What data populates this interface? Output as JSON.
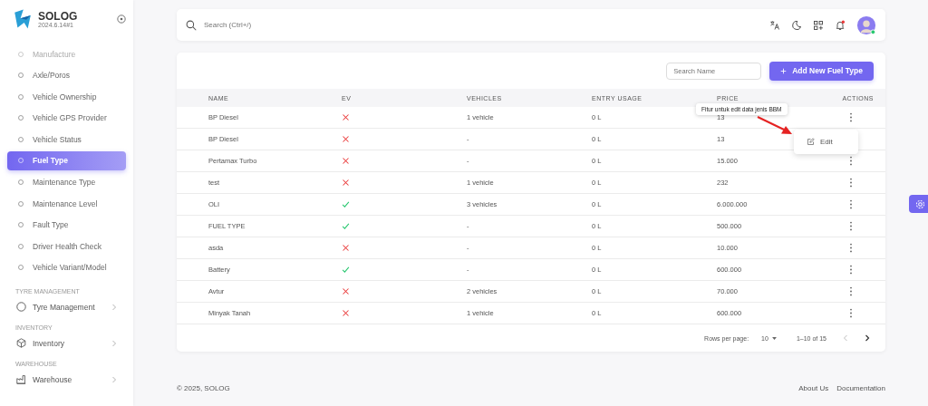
{
  "brand": {
    "name": "SOLOG",
    "version": "2024.6.14#1"
  },
  "sidebar": {
    "items": [
      {
        "label": "Manufacture",
        "selected": false
      },
      {
        "label": "Axle/Poros",
        "selected": false
      },
      {
        "label": "Vehicle Ownership",
        "selected": false
      },
      {
        "label": "Vehicle GPS Provider",
        "selected": false
      },
      {
        "label": "Vehicle Status",
        "selected": false
      },
      {
        "label": "Fuel Type",
        "selected": true
      },
      {
        "label": "Maintenance Type",
        "selected": false
      },
      {
        "label": "Maintenance Level",
        "selected": false
      },
      {
        "label": "Fault Type",
        "selected": false
      },
      {
        "label": "Driver Health Check",
        "selected": false
      },
      {
        "label": "Vehicle Variant/Model",
        "selected": false
      }
    ],
    "sections": [
      {
        "heading": "TYRE MANAGEMENT",
        "item": {
          "label": "Tyre Management",
          "kind": "tyre"
        }
      },
      {
        "heading": "INVENTORY",
        "item": {
          "label": "Inventory",
          "kind": "cube"
        }
      },
      {
        "heading": "WAREHOUSE",
        "item": {
          "label": "Warehouse",
          "kind": "factory"
        }
      }
    ]
  },
  "search": {
    "placeholder": "Search (Ctrl+/)"
  },
  "table_toolbar": {
    "search_placeholder": "Search Name",
    "add_button": "Add New Fuel Type"
  },
  "table": {
    "columns": [
      "NAME",
      "EV",
      "VEHICLES",
      "ENTRY USAGE",
      "PRICE",
      "ACTIONS"
    ],
    "rows": [
      {
        "name": "BP Diesel",
        "ev": false,
        "vehicles": "1 vehicle",
        "entry_usage": "0 L",
        "price": "13"
      },
      {
        "name": "BP Diesel",
        "ev": false,
        "vehicles": "-",
        "entry_usage": "0 L",
        "price": "13"
      },
      {
        "name": "Pertamax Turbo",
        "ev": false,
        "vehicles": "-",
        "entry_usage": "0 L",
        "price": "15.000"
      },
      {
        "name": "test",
        "ev": false,
        "vehicles": "1 vehicle",
        "entry_usage": "0 L",
        "price": "232"
      },
      {
        "name": "OLI",
        "ev": true,
        "vehicles": "3 vehicles",
        "entry_usage": "0 L",
        "price": "6.000.000"
      },
      {
        "name": "FUEL TYPE",
        "ev": true,
        "vehicles": "-",
        "entry_usage": "0 L",
        "price": "500.000"
      },
      {
        "name": "asda",
        "ev": false,
        "vehicles": "-",
        "entry_usage": "0 L",
        "price": "10.000"
      },
      {
        "name": "Battery",
        "ev": true,
        "vehicles": "-",
        "entry_usage": "0 L",
        "price": "600.000"
      },
      {
        "name": "Avtur",
        "ev": false,
        "vehicles": "2 vehicles",
        "entry_usage": "0 L",
        "price": "70.000"
      },
      {
        "name": "Minyak Tanah",
        "ev": false,
        "vehicles": "1 vehicle",
        "entry_usage": "0 L",
        "price": "600.000"
      }
    ]
  },
  "tooltip": "Fitur untuk edit data jenis BBM",
  "action_menu": {
    "items": [
      "Edit"
    ]
  },
  "pagination": {
    "rows_per_page_label": "Rows per page:",
    "rows_per_page": "10",
    "range": "1–10 of 15"
  },
  "footer": {
    "copyright": "© 2025, SOLOG",
    "links": [
      "About Us",
      "Documentation"
    ]
  }
}
